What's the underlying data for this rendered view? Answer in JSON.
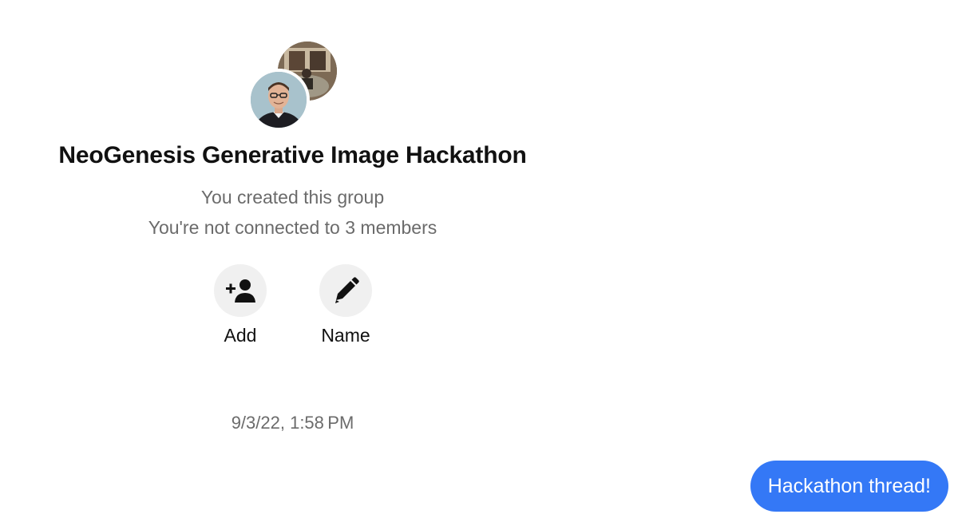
{
  "group": {
    "title": "NeoGenesis Generative Image Hackathon",
    "created_text": "You created this group",
    "connection_text": "You're not connected to 3 members"
  },
  "actions": {
    "add": {
      "label": "Add",
      "icon": "add-person-icon"
    },
    "name": {
      "label": "Name",
      "icon": "pencil-icon"
    }
  },
  "thread": {
    "timestamp": "9/3/22, 1:58 PM",
    "messages": [
      {
        "text": "Hackathon thread!",
        "from": "me",
        "color": "#3478f6"
      }
    ]
  }
}
